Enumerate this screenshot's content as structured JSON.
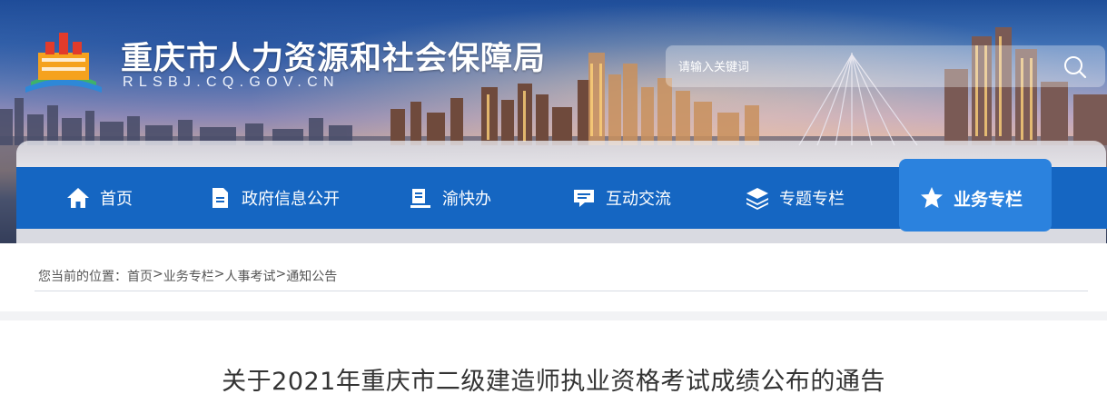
{
  "header": {
    "site_title": "重庆市人力资源和社会保障局",
    "site_domain": "RLSBJ.CQ.GOV.CN",
    "logo_icon": "emblem-icon",
    "search": {
      "placeholder": "请输入关键词",
      "icon": "search-icon"
    }
  },
  "nav": {
    "items": [
      {
        "label": "首页",
        "icon": "home-icon"
      },
      {
        "label": "政府信息公开",
        "icon": "document-icon"
      },
      {
        "label": "渝快办",
        "icon": "clipboard-icon"
      },
      {
        "label": "互动交流",
        "icon": "chat-icon"
      },
      {
        "label": "专题专栏",
        "icon": "layers-icon"
      },
      {
        "label": "业务专栏",
        "icon": "star-icon",
        "active": true
      }
    ],
    "colors": {
      "bar": "#1566c2",
      "active": "#2b82de"
    }
  },
  "breadcrumb": {
    "prefix": "您当前的位置：",
    "items": [
      "首页",
      "业务专栏",
      "人事考试",
      "通知公告"
    ],
    "separator": ">"
  },
  "article": {
    "title": "关于2021年重庆市二级建造师执业资格考试成绩公布的通告"
  }
}
